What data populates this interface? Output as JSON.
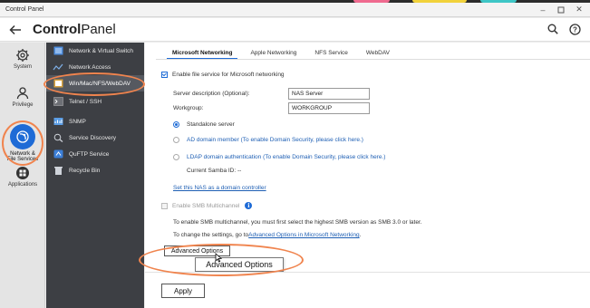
{
  "window": {
    "title": "Control Panel"
  },
  "header": {
    "title_bold": "Control",
    "title_light": "Panel"
  },
  "icon_nav": [
    {
      "label": "System"
    },
    {
      "label": "Privilege"
    },
    {
      "label_line1": "Network &",
      "label_line2": "File Services"
    },
    {
      "label": "Applications"
    }
  ],
  "sub_nav": [
    {
      "label": "Network & Virtual Switch",
      "icon": "network-switch-icon"
    },
    {
      "label": "Network Access",
      "icon": "network-access-icon"
    },
    {
      "label": "Win/Mac/NFS/WebDAV",
      "icon": "win-mac-icon"
    },
    {
      "label": "Telnet / SSH",
      "icon": "terminal-icon"
    },
    {
      "label": "SNMP",
      "icon": "snmp-icon"
    },
    {
      "label": "Service Discovery",
      "icon": "service-discovery-icon"
    },
    {
      "label": "QuFTP Service",
      "icon": "ftp-icon"
    },
    {
      "label": "Recycle Bin",
      "icon": "recycle-bin-icon"
    }
  ],
  "tabs": [
    "Microsoft Networking",
    "Apple Networking",
    "NFS Service",
    "WebDAV"
  ],
  "form": {
    "enable_file_service": "Enable file service for Microsoft networking",
    "server_description_label": "Server description (Optional):",
    "server_description_value": "NAS Server",
    "workgroup_label": "Workgroup:",
    "workgroup_value": "WORKGROUP",
    "standalone": "Standalone server",
    "ad_member": "AD domain member (To enable Domain Security, please click here.)",
    "ldap": "LDAP domain authentication (To enable Domain Security, please click here.)",
    "samba_id": "Current Samba ID: --",
    "set_dc_link": "Set this NAS as a domain controller",
    "enable_smb_multichannel": "Enable SMB Multichannel",
    "info_glyph": "i",
    "smb_note": "To enable SMB multichannel, you must first select the highest SMB version as SMB 3.0 or later.",
    "change_prefix": "To change the settings, go to ",
    "change_link": "Advanced Options in Microsoft Networking",
    "change_suffix": ".",
    "advanced_button": "Advanced Options",
    "advanced_callout": "Advanced Options"
  },
  "footer": {
    "apply": "Apply"
  },
  "colors": {
    "accent": "#1e6bd6",
    "annotation": "#f0844e",
    "sidebar_dark": "#3d3f44"
  }
}
